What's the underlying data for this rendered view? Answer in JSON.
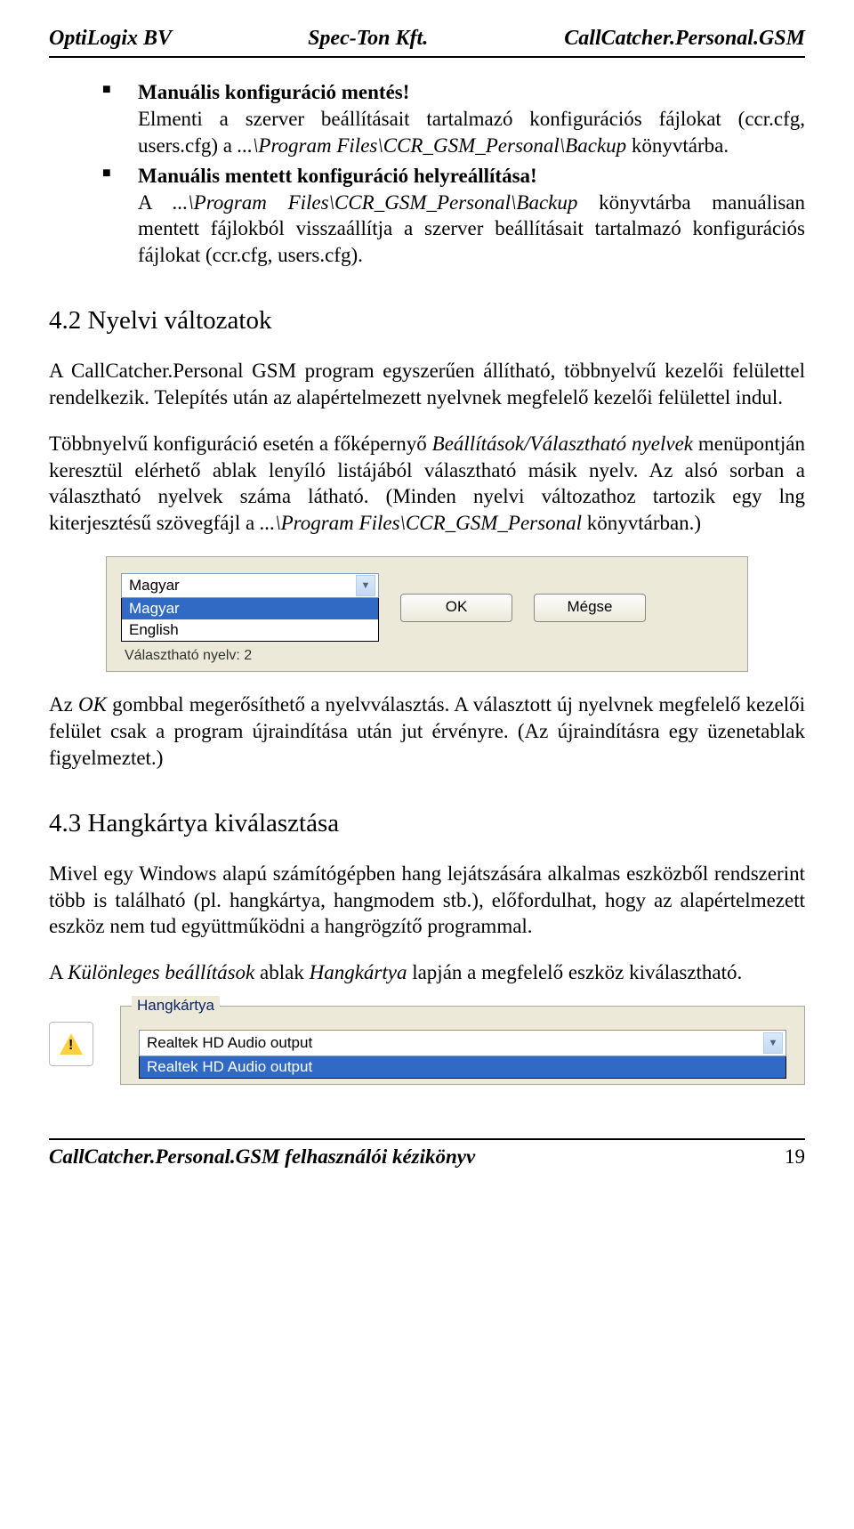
{
  "header": {
    "left": "OptiLogix BV",
    "center": "Spec-Ton Kft.",
    "right": "CallCatcher.Personal.GSM"
  },
  "bullets": {
    "b1_bold": "Manuális konfiguráció mentés!",
    "b1_rest_a": "Elmenti a szerver beállításait tartalmazó konfigurációs fájlokat (ccr.cfg, users.cfg) a",
    "b1_path": "...\\Program Files\\CCR_GSM_Personal\\Backup",
    "b1_rest_b": " könyvtárba.",
    "b2_bold": "Manuális mentett konfiguráció helyreállítása!",
    "b2_rest_a": "A ",
    "b2_path": "...\\Program Files\\CCR_GSM_Personal\\Backup",
    "b2_rest_b": " könyvtárba manuálisan mentett fájlokból visszaállítja a szerver beállításait tartalmazó konfigurációs fájlokat (ccr.cfg, users.cfg)."
  },
  "sec42": {
    "title": "4.2  Nyelvi változatok",
    "p1": "A CallCatcher.Personal GSM program egyszerűen állítható, többnyelvű kezelői felülettel rendelkezik. Telepítés után az alapértelmezett nyelvnek megfelelő kezelői felülettel indul.",
    "p2_a": "Többnyelvű konfiguráció esetén a főképernyő ",
    "p2_ital": "Beállítások/Választható nyelvek",
    "p2_b": " menüpontján keresztül elérhető ablak lenyíló listájából választható másik nyelv. Az alsó sorban a választható nyelvek száma látható. (Minden nyelvi változathoz tartozik egy lng kiterjesztésű szövegfájl a ",
    "p2_path": "...\\Program Files\\CCR_GSM_Personal",
    "p2_c": " könyvtárban.)",
    "p3_a": "Az ",
    "p3_ital": "OK",
    "p3_b": " gombbal megerősíthető a nyelvválasztás. A választott új nyelvnek megfelelő kezelői felület csak a program újraindítása után jut érvényre. (Az újraindításra egy üzenetablak figyelmeztet.)"
  },
  "lang_ui": {
    "selected": "Magyar",
    "options": [
      "Magyar",
      "English"
    ],
    "status": "Választható nyelv: 2",
    "ok": "OK",
    "cancel": "Mégse"
  },
  "sec43": {
    "title": "4.3  Hangkártya kiválasztása",
    "p1": "Mivel egy Windows alapú számítógépben hang lejátszására alkalmas eszközből rendszerint több is található (pl. hangkártya, hangmodem stb.), előfordulhat, hogy az alapértelmezett eszköz nem tud együttműködni a hangrögzítő programmal.",
    "p2_a": "A ",
    "p2_ital1": "Különleges beállítások",
    "p2_b": " ablak ",
    "p2_ital2": "Hangkártya",
    "p2_c": " lapján a megfelelő eszköz kiválasztható."
  },
  "sc_ui": {
    "fieldset": "Hangkártya",
    "selected": "Realtek HD Audio output",
    "options": [
      "Realtek HD Audio output"
    ]
  },
  "footer": {
    "left": "CallCatcher.Personal.GSM felhasználói kézikönyv",
    "page": "19"
  }
}
